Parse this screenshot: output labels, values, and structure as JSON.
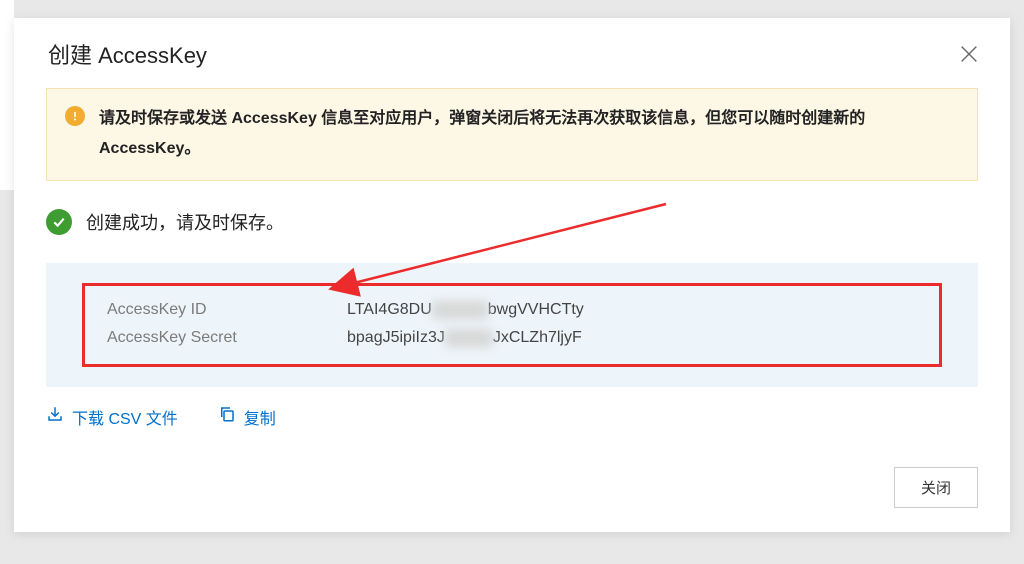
{
  "modal": {
    "title": "创建 AccessKey",
    "warning": "请及时保存或发送 AccessKey 信息至对应用户，弹窗关闭后将无法再次获取该信息，但您可以随时创建新的 AccessKey。",
    "success": "创建成功，请及时保存。",
    "keys": {
      "id_label": "AccessKey ID",
      "id_value_pre": "LTAI4G8DU",
      "id_value_post": "bwgVVHCTty",
      "secret_label": "AccessKey Secret",
      "secret_value_pre": "bpagJ5ipiIz3J",
      "secret_value_post": "JxCLZh7ljyF"
    },
    "actions": {
      "download": "下载 CSV 文件",
      "copy": "复制"
    },
    "close_btn": "关闭"
  },
  "colors": {
    "accent_blue": "#0070cc",
    "warn_bg": "#fdf7e6",
    "warn_icon": "#f2ad31",
    "success_icon": "#3e9c33",
    "info_bg": "#eef5fa",
    "highlight_border": "#ec2c2c"
  }
}
